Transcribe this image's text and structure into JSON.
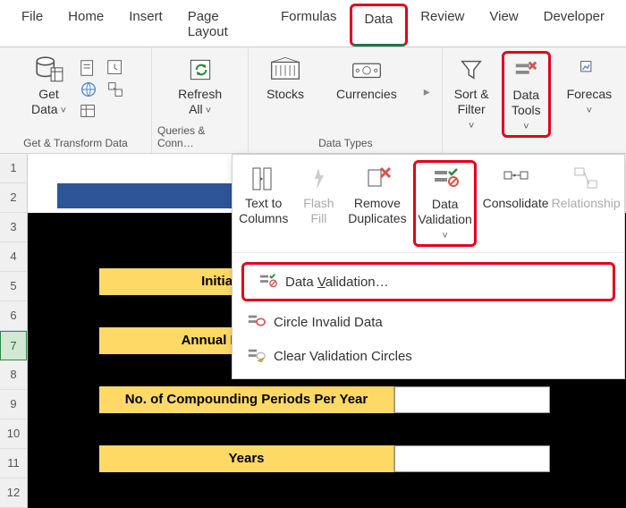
{
  "tabs": {
    "file": "File",
    "home": "Home",
    "insert": "Insert",
    "page_layout": "Page Layout",
    "formulas": "Formulas",
    "data": "Data",
    "review": "Review",
    "view": "View",
    "developer": "Developer"
  },
  "ribbon": {
    "get_data": "Get\nData",
    "group_get": "Get & Transform Data",
    "refresh_all": "Refresh\nAll",
    "group_queries": "Queries & Conn…",
    "stocks": "Stocks",
    "currencies": "Currencies",
    "group_types": "Data Types",
    "sort_filter": "Sort &\nFilter",
    "data_tools": "Data\nTools",
    "forecast": "Forecas"
  },
  "tools_panel": {
    "text_to_columns": "Text to\nColumns",
    "flash_fill": "Flash\nFill",
    "remove_dup": "Remove\nDuplicates",
    "data_validation": "Data\nValidation",
    "consolidate": "Consolidate",
    "relationships": "Relationship"
  },
  "menu": {
    "data_validation": "Data Validation…",
    "circle_invalid": "Circle Invalid Data",
    "clear_circles": "Clear Validation Circles"
  },
  "rows": [
    "1",
    "2",
    "3",
    "4",
    "5",
    "6",
    "7",
    "8",
    "9",
    "10",
    "11",
    "12"
  ],
  "fields": {
    "initial_balance": "Initial Balance",
    "annual_rate": "Annual Interest Rate",
    "periods": "No. of Compounding Periods Per Year",
    "years": "Years"
  }
}
